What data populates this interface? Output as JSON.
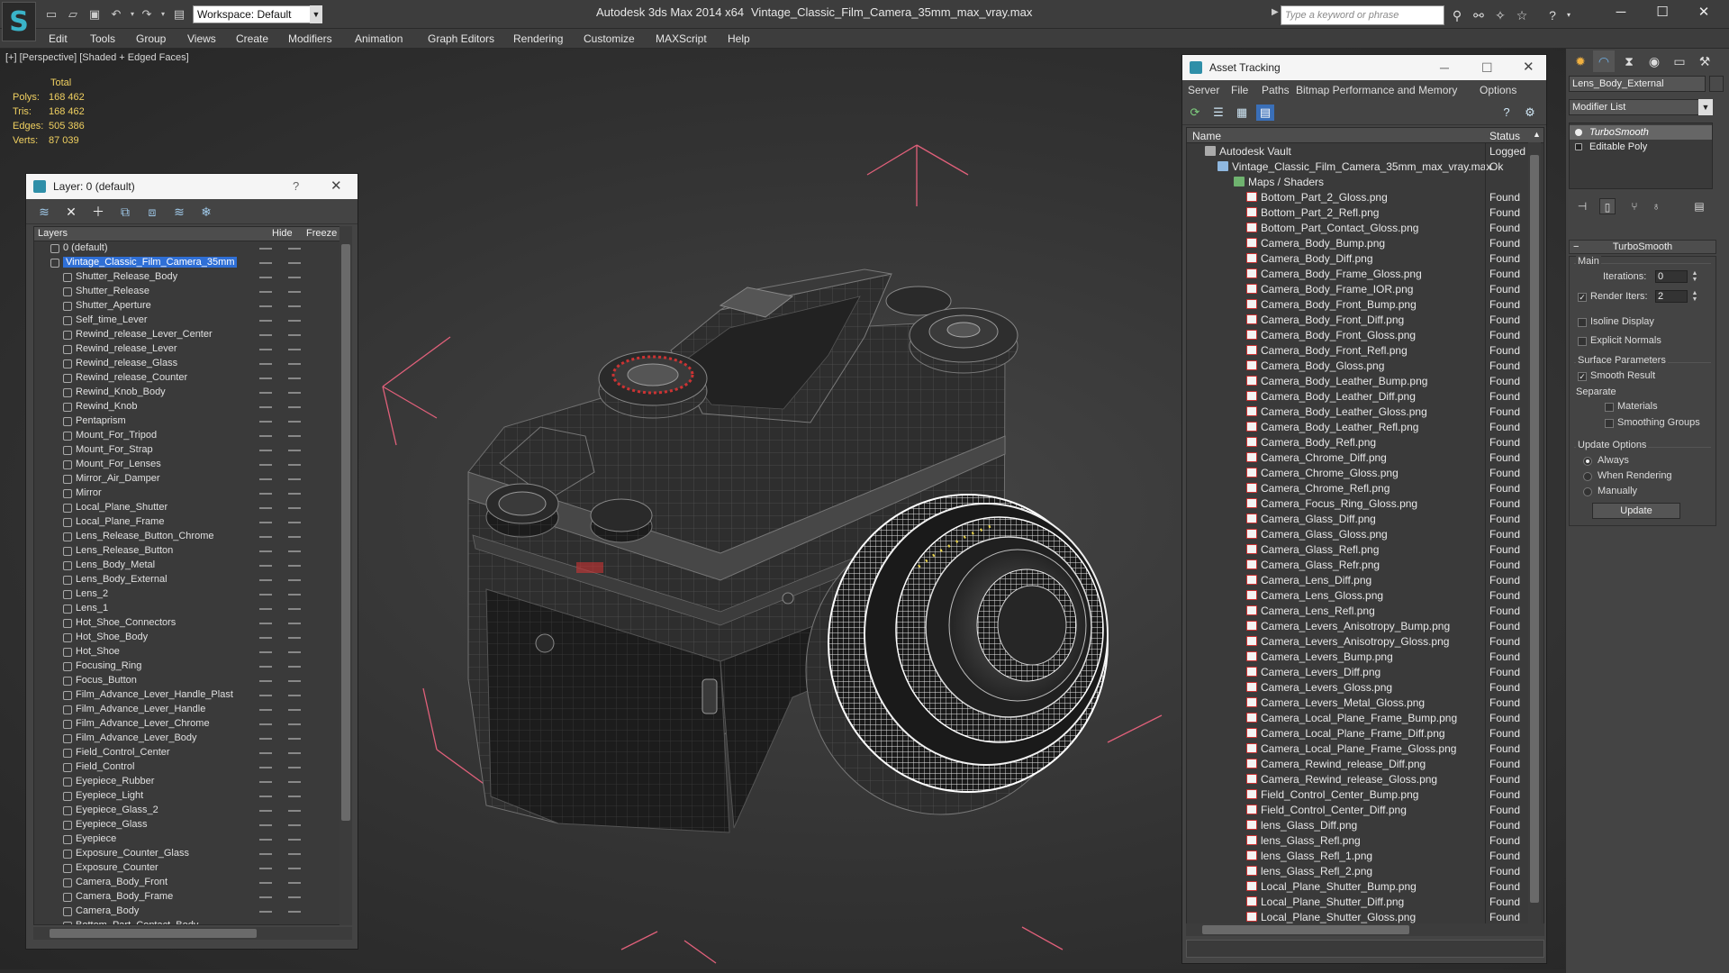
{
  "titlebar": {
    "workspace": "Workspace: Default",
    "app_title": "Autodesk 3ds Max  2014 x64",
    "file_title": "Vintage_Classic_Film_Camera_35mm_max_vray.max",
    "search_placeholder": "Type a keyword or phrase"
  },
  "menu": [
    "Edit",
    "Tools",
    "Group",
    "Views",
    "Create",
    "Modifiers",
    "Animation",
    "Graph Editors",
    "Rendering",
    "Customize",
    "MAXScript",
    "Help"
  ],
  "viewport": {
    "label": "[+] [Perspective] [Shaded + Edged Faces]",
    "stats": {
      "total_label": "Total",
      "polys_label": "Polys:",
      "polys": "168 462",
      "tris_label": "Tris:",
      "tris": "168 462",
      "edges_label": "Edges:",
      "edges": "505 386",
      "verts_label": "Verts:",
      "verts": "87 039"
    }
  },
  "layer_panel": {
    "title": "Layer: 0 (default)",
    "help": "?",
    "columns": {
      "layers": "Layers",
      "hide": "Hide",
      "freeze": "Freeze"
    },
    "items": [
      "0 (default)",
      "Vintage_Classic_Film_Camera_35mm",
      "Shutter_Release_Body",
      "Shutter_Release",
      "Shutter_Aperture",
      "Self_time_Lever",
      "Rewind_release_Lever_Center",
      "Rewind_release_Lever",
      "Rewind_release_Glass",
      "Rewind_release_Counter",
      "Rewind_Knob_Body",
      "Rewind_Knob",
      "Pentaprism",
      "Mount_For_Tripod",
      "Mount_For_Strap",
      "Mount_For_Lenses",
      "Mirror_Air_Damper",
      "Mirror",
      "Local_Plane_Shutter",
      "Local_Plane_Frame",
      "Lens_Release_Button_Chrome",
      "Lens_Release_Button",
      "Lens_Body_Metal",
      "Lens_Body_External",
      "Lens_2",
      "Lens_1",
      "Hot_Shoe_Connectors",
      "Hot_Shoe_Body",
      "Hot_Shoe",
      "Focusing_Ring",
      "Focus_Button",
      "Film_Advance_Lever_Handle_Plast",
      "Film_Advance_Lever_Handle",
      "Film_Advance_Lever_Chrome",
      "Film_Advance_Lever_Body",
      "Field_Control_Center",
      "Field_Control",
      "Eyepiece_Rubber",
      "Eyepiece_Light",
      "Eyepiece_Glass_2",
      "Eyepiece_Glass",
      "Eyepiece",
      "Exposure_Counter_Glass",
      "Exposure_Counter",
      "Camera_Body_Front",
      "Camera_Body_Frame",
      "Camera_Body",
      "Bottom_Part_Contact_Body"
    ]
  },
  "asset_panel": {
    "title": "Asset Tracking",
    "menu": [
      "Server",
      "File",
      "Paths",
      "Bitmap Performance and Memory",
      "Options"
    ],
    "columns": {
      "name": "Name",
      "status": "Status"
    },
    "vault": {
      "name": "Autodesk Vault",
      "status": "Logged"
    },
    "file": {
      "name": "Vintage_Classic_Film_Camera_35mm_max_vray.max",
      "status": "Ok"
    },
    "maps_label": "Maps / Shaders",
    "found": "Found",
    "maps": [
      "Bottom_Part_2_Gloss.png",
      "Bottom_Part_2_Refl.png",
      "Bottom_Part_Contact_Gloss.png",
      "Camera_Body_Bump.png",
      "Camera_Body_Diff.png",
      "Camera_Body_Frame_Gloss.png",
      "Camera_Body_Frame_IOR.png",
      "Camera_Body_Front_Bump.png",
      "Camera_Body_Front_Diff.png",
      "Camera_Body_Front_Gloss.png",
      "Camera_Body_Front_Refl.png",
      "Camera_Body_Gloss.png",
      "Camera_Body_Leather_Bump.png",
      "Camera_Body_Leather_Diff.png",
      "Camera_Body_Leather_Gloss.png",
      "Camera_Body_Leather_Refl.png",
      "Camera_Body_Refl.png",
      "Camera_Chrome_Diff.png",
      "Camera_Chrome_Gloss.png",
      "Camera_Chrome_Refl.png",
      "Camera_Focus_Ring_Gloss.png",
      "Camera_Glass_Diff.png",
      "Camera_Glass_Gloss.png",
      "Camera_Glass_Refl.png",
      "Camera_Glass_Refr.png",
      "Camera_Lens_Diff.png",
      "Camera_Lens_Gloss.png",
      "Camera_Lens_Refl.png",
      "Camera_Levers_Anisotropy_Bump.png",
      "Camera_Levers_Anisotropy_Gloss.png",
      "Camera_Levers_Bump.png",
      "Camera_Levers_Diff.png",
      "Camera_Levers_Gloss.png",
      "Camera_Levers_Metal_Gloss.png",
      "Camera_Local_Plane_Frame_Bump.png",
      "Camera_Local_Plane_Frame_Diff.png",
      "Camera_Local_Plane_Frame_Gloss.png",
      "Camera_Rewind_release_Diff.png",
      "Camera_Rewind_release_Gloss.png",
      "Field_Control_Center_Bump.png",
      "Field_Control_Center_Diff.png",
      "lens_Glass_Diff.png",
      "lens_Glass_Refl.png",
      "lens_Glass_Refl_1.png",
      "lens_Glass_Refl_2.png",
      "Local_Plane_Shutter_Bump.png",
      "Local_Plane_Shutter_Diff.png",
      "Local_Plane_Shutter_Gloss.png"
    ]
  },
  "command_panel": {
    "object_name": "Lens_Body_External",
    "modifier_list": "Modifier List",
    "stack": [
      "TurboSmooth",
      "Editable Poly"
    ],
    "rollout_title": "TurboSmooth",
    "main_label": "Main",
    "iterations_label": "Iterations:",
    "iterations": "0",
    "render_iters_label": "Render Iters:",
    "render_iters": "2",
    "isoline_label": "Isoline Display",
    "explicit_normals_label": "Explicit Normals",
    "surface_params_label": "Surface Parameters",
    "smooth_result_label": "Smooth Result",
    "separate_label": "Separate",
    "materials_label": "Materials",
    "smoothing_groups_label": "Smoothing Groups",
    "update_options_label": "Update Options",
    "always_label": "Always",
    "when_rendering_label": "When Rendering",
    "manually_label": "Manually",
    "update_button": "Update",
    "check_mark": "✓"
  },
  "colors": {
    "selection": "#2f6fd6",
    "stats_yellow": "#f0d060",
    "bbox_pink": "#e0607a",
    "accent_teal": "#3ab4c9"
  }
}
